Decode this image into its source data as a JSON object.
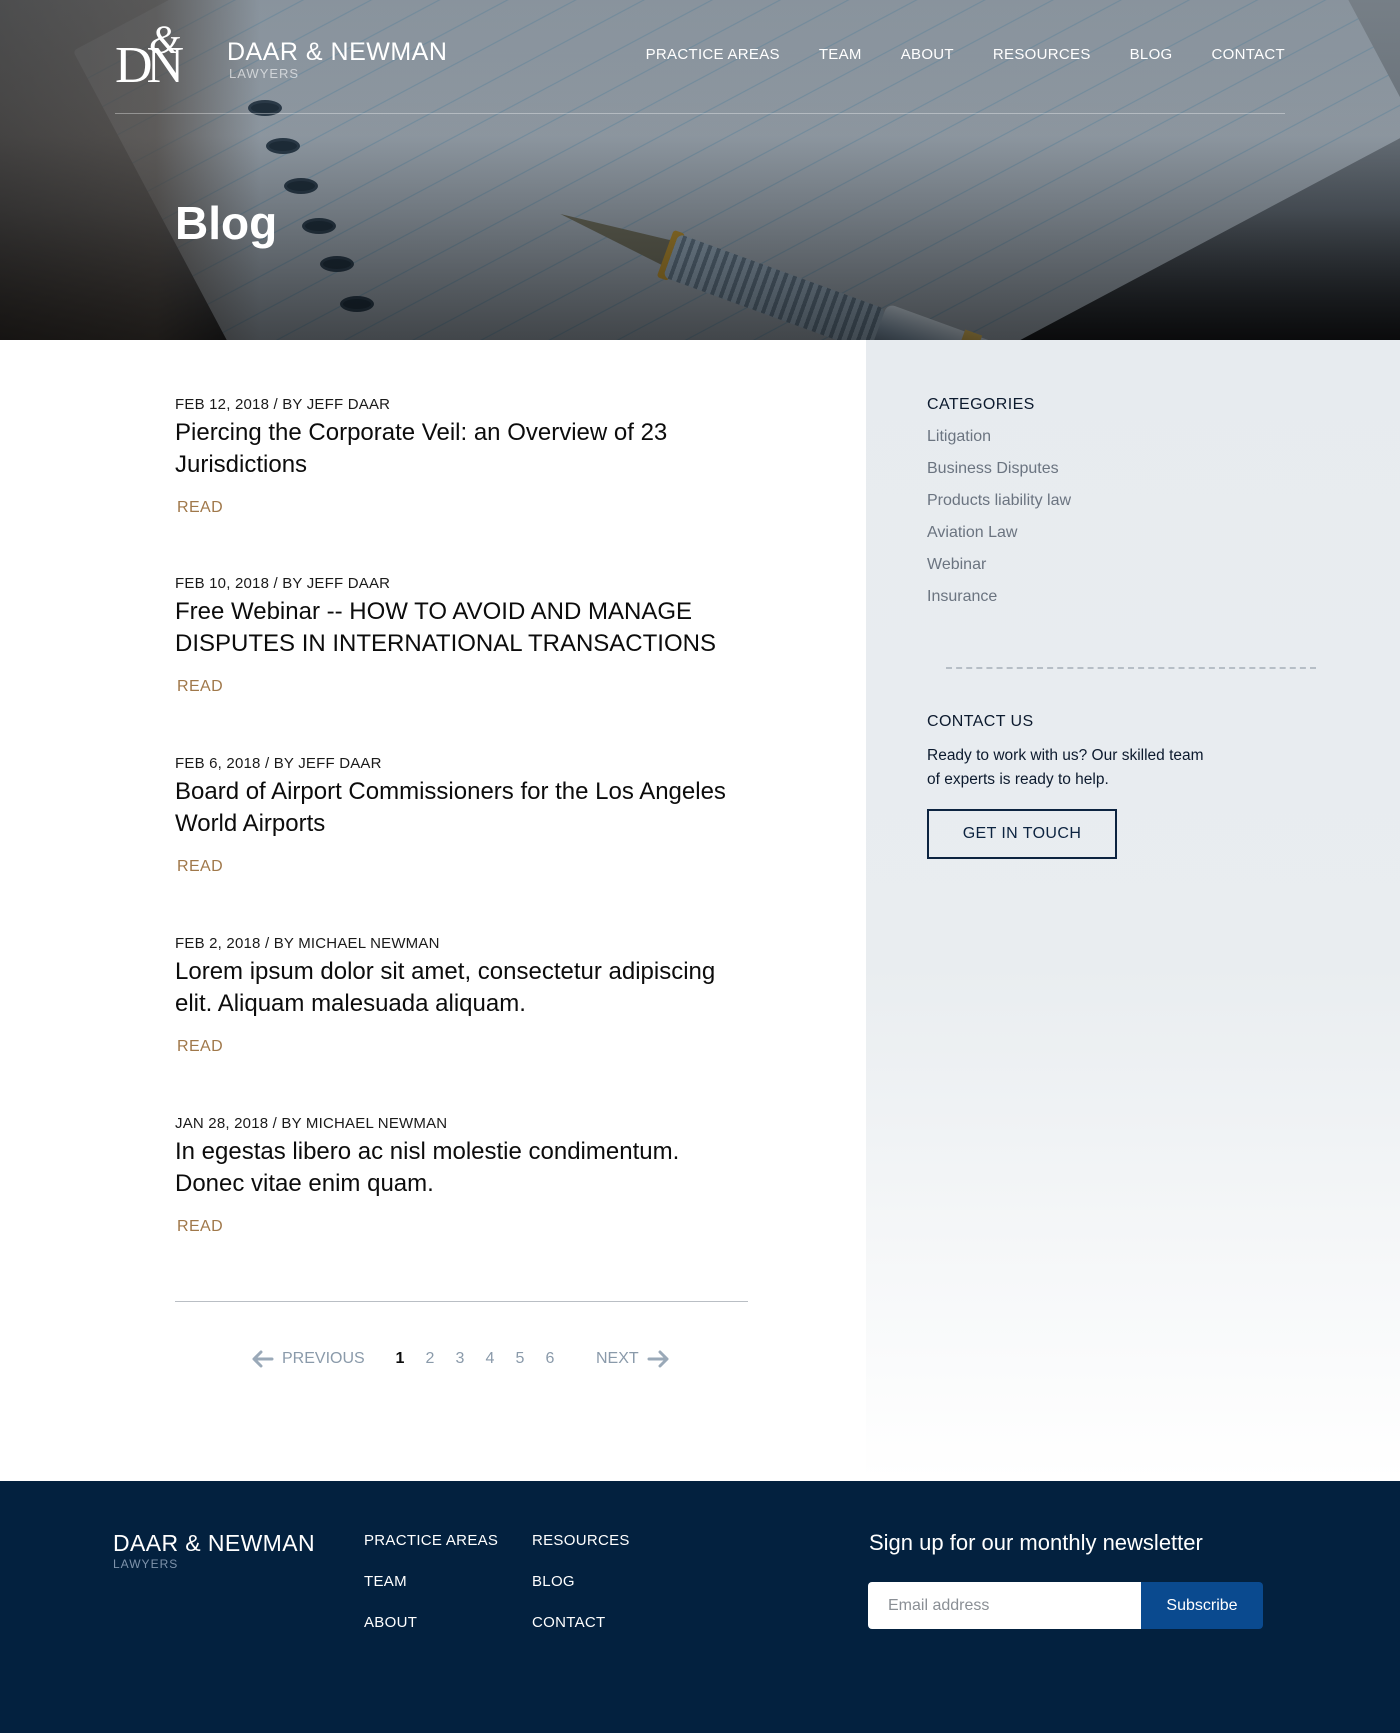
{
  "header": {
    "logo_monogram": "D&N",
    "brand": "DAAR & NEWMAN",
    "brand_sub": "LAWYERS",
    "nav": [
      "PRACTICE AREAS",
      "TEAM",
      "ABOUT",
      "RESOURCES",
      "BLOG",
      "CONTACT"
    ],
    "page_title": "Blog"
  },
  "posts": [
    {
      "meta": "FEB 12, 2018 / BY JEFF DAAR",
      "title": "Piercing the Corporate Veil: an Overview of 23 Jurisdictions",
      "read": "READ"
    },
    {
      "meta": "FEB 10, 2018 / BY JEFF DAAR",
      "title": "Free Webinar -- HOW TO AVOID AND MANAGE DISPUTES IN INTERNATIONAL TRANSACTIONS",
      "read": "READ"
    },
    {
      "meta": "FEB 6, 2018 / BY JEFF DAAR",
      "title": "Board of Airport Commissioners for the Los Angeles World Airports",
      "read": "READ"
    },
    {
      "meta": "FEB 2, 2018 / BY MICHAEL NEWMAN",
      "title": "Lorem ipsum dolor sit amet, consectetur adipiscing elit. Aliquam malesuada aliquam.",
      "read": "READ"
    },
    {
      "meta": "JAN 28, 2018 / BY MICHAEL NEWMAN",
      "title": "In egestas libero ac nisl molestie condimentum. Donec vitae enim quam.",
      "read": "READ"
    }
  ],
  "pagination": {
    "prev": "PREVIOUS",
    "next": "NEXT",
    "pages": [
      "1",
      "2",
      "3",
      "4",
      "5",
      "6"
    ],
    "current": "1"
  },
  "sidebar": {
    "categories_heading": "CATEGORIES",
    "categories": [
      "Litigation",
      "Business Disputes",
      "Products liability law",
      "Aviation Law",
      "Webinar",
      "Insurance"
    ],
    "contact_heading": "CONTACT US",
    "contact_text": "Ready to work with us? Our skilled team of experts is ready to help.",
    "contact_button": "GET IN TOUCH"
  },
  "footer": {
    "brand": "DAAR & NEWMAN",
    "brand_sub": "LAWYERS",
    "links_col1": [
      "PRACTICE AREAS",
      "TEAM",
      "ABOUT"
    ],
    "links_col2": [
      "RESOURCES",
      "BLOG",
      "CONTACT"
    ],
    "newsletter_heading": "Sign up for our monthly newsletter",
    "email_placeholder": "Email address",
    "subscribe_label": "Subscribe"
  },
  "colors": {
    "navy": "#03213f",
    "accent_gold": "#a0784a",
    "button_blue": "#0a4a8f",
    "sidebar_bg": "#e7ebef"
  }
}
